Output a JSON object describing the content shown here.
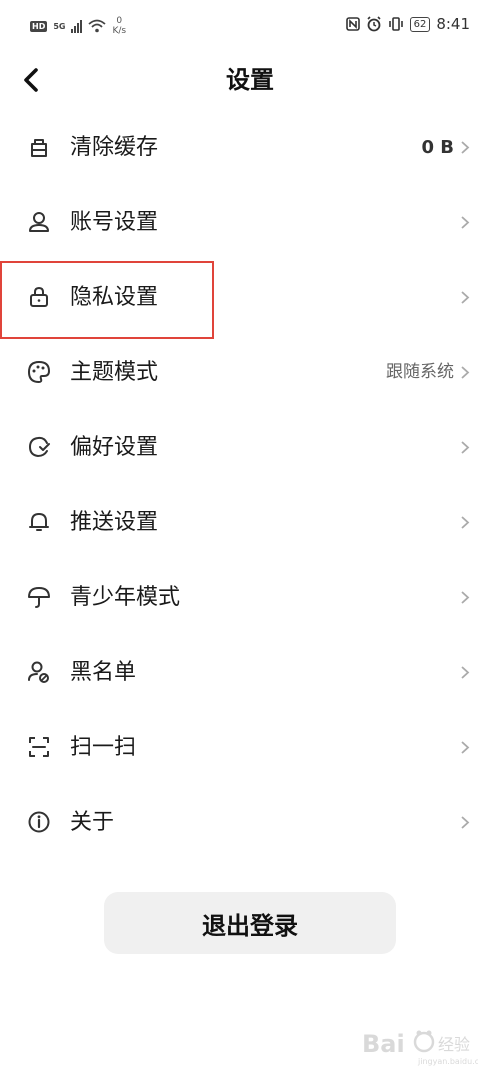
{
  "status_bar": {
    "hd": "HD",
    "net_type": "5G",
    "net_speed": "0",
    "net_unit": "K/s",
    "battery": "62",
    "time": "8:41",
    "icons": [
      "nfc-icon",
      "alarm-icon",
      "vibrate-icon"
    ]
  },
  "header": {
    "title": "设置",
    "back_icon": "back-arrow-icon"
  },
  "settings": [
    {
      "label": "清除缓存",
      "value": "0 B",
      "icon": "broom-icon"
    },
    {
      "label": "账号设置",
      "value": "",
      "icon": "user-icon"
    },
    {
      "label": "隐私设置",
      "value": "",
      "icon": "lock-icon"
    },
    {
      "label": "主题模式",
      "value": "跟随系统",
      "icon": "palette-icon"
    },
    {
      "label": "偏好设置",
      "value": "",
      "icon": "preference-icon"
    },
    {
      "label": "推送设置",
      "value": "",
      "icon": "bell-icon"
    },
    {
      "label": "青少年模式",
      "value": "",
      "icon": "umbrella-icon"
    },
    {
      "label": "黑名单",
      "value": "",
      "icon": "user-block-icon"
    },
    {
      "label": "扫一扫",
      "value": "",
      "icon": "scan-icon"
    },
    {
      "label": "关于",
      "value": "",
      "icon": "info-icon"
    }
  ],
  "logout_label": "退出登录",
  "colors": {
    "highlight": "#e0443a",
    "button_bg": "#f0f0f0"
  }
}
